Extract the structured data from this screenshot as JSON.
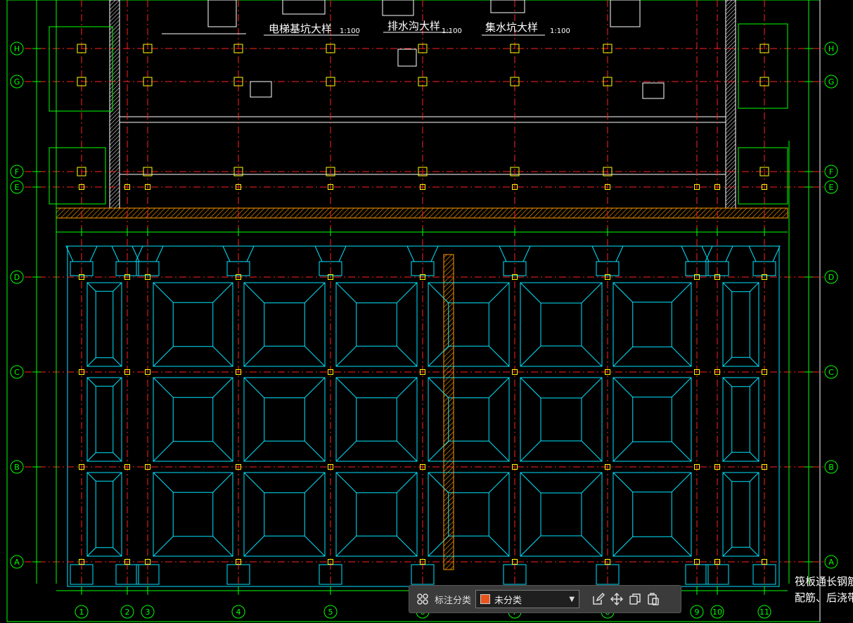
{
  "drawing": {
    "grid_columns": [
      "1",
      "2",
      "3",
      "4",
      "5",
      "6",
      "7",
      "8",
      "9",
      "10",
      "11"
    ],
    "grid_rows": [
      "H",
      "G",
      "F",
      "E",
      "D",
      "C",
      "B",
      "A"
    ],
    "detail_titles": [
      {
        "text": "电梯基坑大样",
        "scale": "1:100"
      },
      {
        "text": "排水沟大样",
        "scale": "1:100"
      },
      {
        "text": "集水坑大样",
        "scale": "1:100"
      }
    ],
    "bottom_right_note_line1": "筏板通长钢筋、柱",
    "bottom_right_note_line2": "配筋、后浇带、沉",
    "colors": {
      "background": "#000000",
      "grid_line": "#ff2020",
      "dim_line": "#00ff00",
      "foundation": "#00e5ff",
      "column": "#ffff00",
      "wall": "#ffffff",
      "hatch": "#ff9900",
      "label_text": "#ffffff"
    }
  },
  "toolbar": {
    "grid_icon": "grid-apps-icon",
    "label": "标注分类",
    "category_value": "未分类",
    "category_color": "#e8541c",
    "edit_icon": "edit-icon",
    "move_icon": "move-icon",
    "copy_icon": "copy-icon",
    "paste_icon": "paste-icon"
  }
}
